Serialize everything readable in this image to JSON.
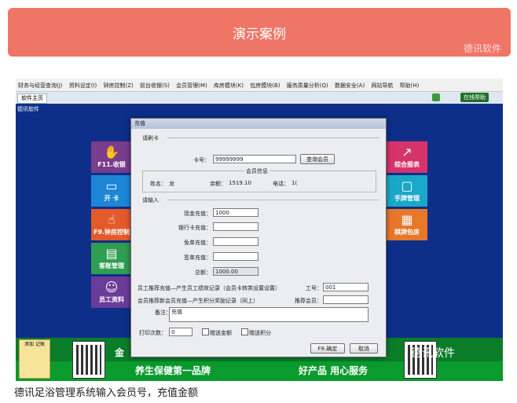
{
  "banner": {
    "title": "演示案例",
    "watermark": "德讯软件"
  },
  "app": {
    "menu": [
      "财务与经营查询(J)",
      "资料设定(I)",
      "钟房控制(Z)",
      "前台收银(S)",
      "会员管理(M)",
      "库房模块(K)",
      "包房模块(B)",
      "服务质量分析(Q)",
      "数据安全(A)",
      "网站导航",
      "帮助(H)"
    ],
    "tab_label": "软件主页",
    "online_label": "在线帮助",
    "company": "德讯软件",
    "left_tiles": [
      {
        "label": "F11.收银",
        "icon": "cash-icon",
        "color": "#7a3c8c"
      },
      {
        "label": "开 卡",
        "icon": "card-icon",
        "color": "#1d86d6"
      },
      {
        "label": "F9.钟房控制",
        "icon": "clock-icon",
        "color": "#e45a2b"
      },
      {
        "label": "客账管理",
        "icon": "ledger-icon",
        "color": "#2f9d52"
      },
      {
        "label": "员工资料",
        "icon": "staff-icon",
        "color": "#6b3b98"
      }
    ],
    "right_tiles": [
      {
        "label": "综合报表",
        "icon": "chart-icon",
        "color": "#d6336b"
      },
      {
        "label": "手牌管理",
        "icon": "tag-icon",
        "color": "#1aa8c9"
      },
      {
        "label": "棋牌包房",
        "icon": "room-icon",
        "color": "#e8772a"
      }
    ],
    "bottom": {
      "slogan1": "养生保健第一品牌",
      "slogan2": "好产品 用心服务",
      "slogan_partial": "金",
      "note": "添加\n记账"
    }
  },
  "dialog": {
    "title": "充值",
    "section_card": "请刷卡",
    "card_label": "卡号：",
    "card_value": "99999999",
    "query_button": "查询会员",
    "member_info_title": "会员信息",
    "name_label": "姓名：",
    "name_value": "龙",
    "balance_label": "余额：",
    "balance_value": "1519.10",
    "phone_label": "电话：",
    "phone_value": "1(",
    "section_input": "请输入",
    "cash_label": "现金充值：",
    "cash_value": "1000",
    "bank_label": "银行卡充值：",
    "bank_value": "",
    "free_label": "免单充值：",
    "free_value": "",
    "sign_label": "签单充值：",
    "sign_value": "",
    "total_label": "总额：",
    "total_value": "1000.00",
    "staff_recommend_text": "员工推荐充值—产生员工绩效记录（会员卡转类设置设置）",
    "staff_no_label": "工号：",
    "staff_no_value": "001",
    "member_recommend_text": "会员推荐新会员充值—产生积分奖励记录（同上）",
    "recommender_label": "推荐会员：",
    "recommender_value": "",
    "remark_label": "备注：",
    "remark_value": "充值",
    "print_label": "打印次数：",
    "print_value": "0",
    "gift_amount_label": "赠送金额",
    "gift_points_label": "赠送积分",
    "confirm_button": "F8.确定",
    "cancel_button": "取消"
  },
  "caption": "德讯足浴管理系统输入会员号，充值金额"
}
